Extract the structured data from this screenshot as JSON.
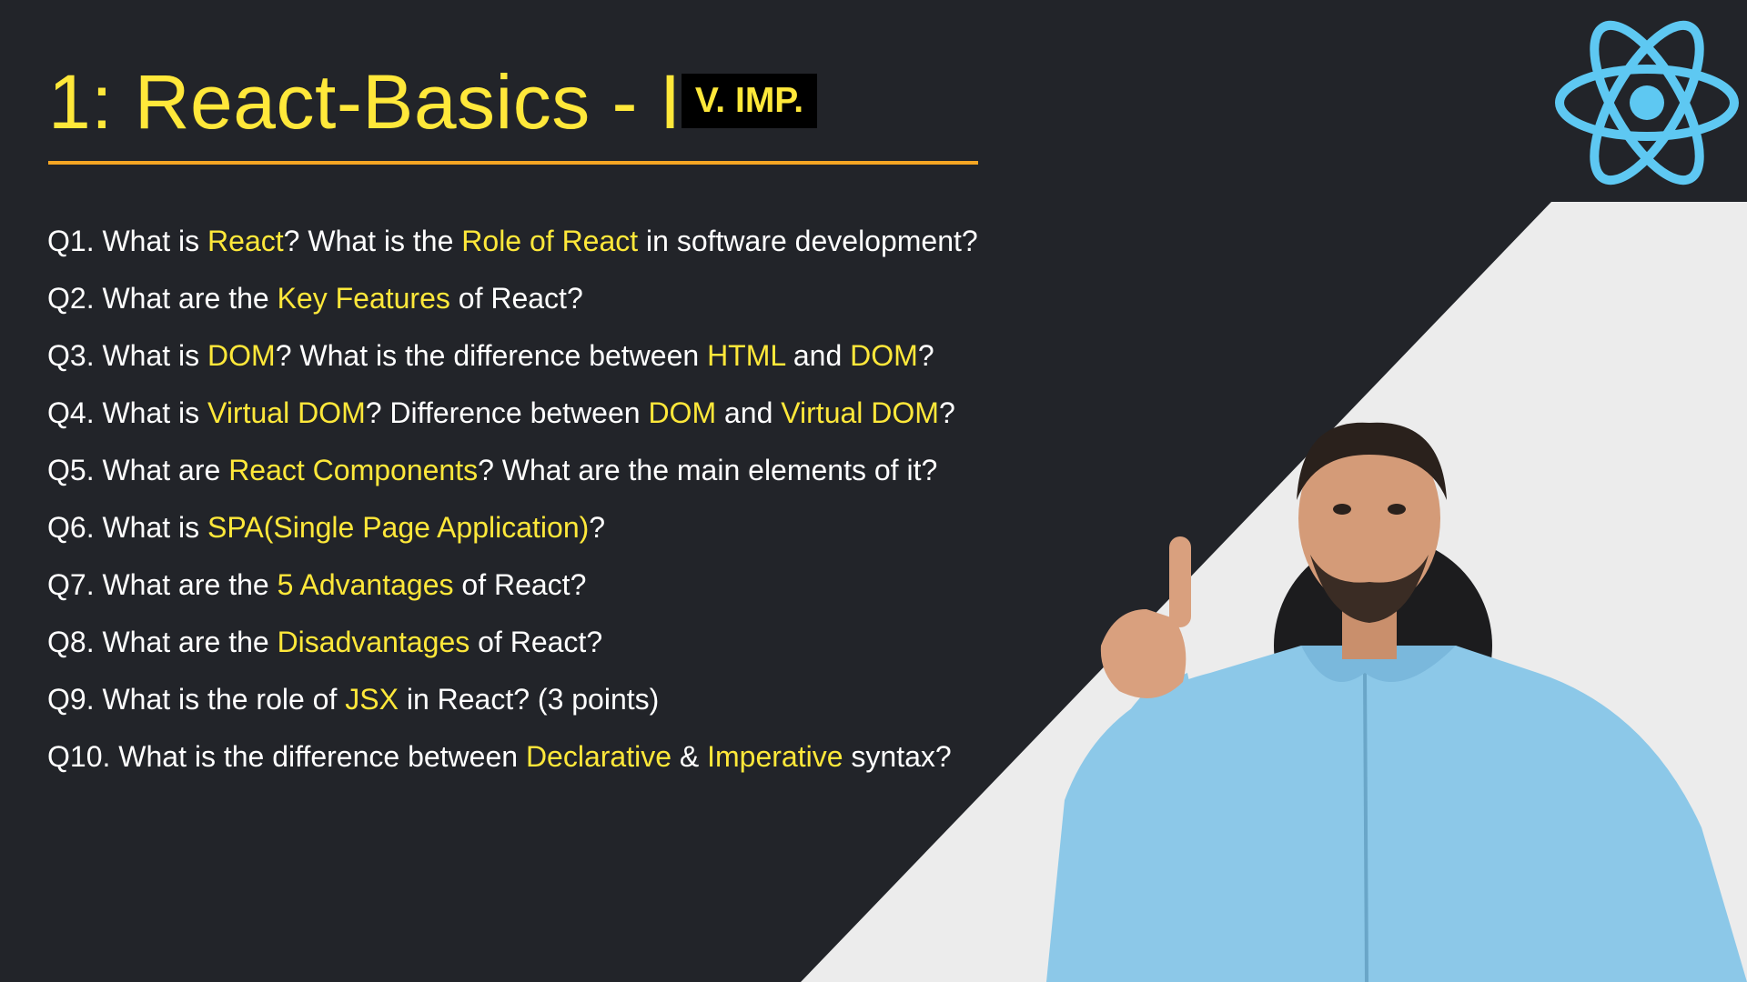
{
  "title": "1: React-Basics - I",
  "badge": "V. IMP.",
  "logo_icon": "react-atom-icon",
  "colors": {
    "background": "#222429",
    "highlight": "#ffe83a",
    "underline": "#f5a623",
    "react_logo": "#5ec8f2",
    "presenter_jacket": "#8cc8e8"
  },
  "questions": [
    {
      "parts": [
        {
          "text": "Q1. What is ",
          "hl": false
        },
        {
          "text": "React",
          "hl": true
        },
        {
          "text": "? What is the ",
          "hl": false
        },
        {
          "text": "Role of React",
          "hl": true
        },
        {
          "text": " in software development?",
          "hl": false
        }
      ]
    },
    {
      "parts": [
        {
          "text": "Q2. What are the ",
          "hl": false
        },
        {
          "text": "Key Features",
          "hl": true
        },
        {
          "text": " of React?",
          "hl": false
        }
      ]
    },
    {
      "parts": [
        {
          "text": "Q3. What is ",
          "hl": false
        },
        {
          "text": "DOM",
          "hl": true
        },
        {
          "text": "? What is the difference between ",
          "hl": false
        },
        {
          "text": "HTML",
          "hl": true
        },
        {
          "text": " and ",
          "hl": false
        },
        {
          "text": "DOM",
          "hl": true
        },
        {
          "text": "?",
          "hl": false
        }
      ]
    },
    {
      "parts": [
        {
          "text": "Q4. What is ",
          "hl": false
        },
        {
          "text": "Virtual DOM",
          "hl": true
        },
        {
          "text": "? Difference between ",
          "hl": false
        },
        {
          "text": "DOM",
          "hl": true
        },
        {
          "text": " and ",
          "hl": false
        },
        {
          "text": "Virtual DOM",
          "hl": true
        },
        {
          "text": "?",
          "hl": false
        }
      ]
    },
    {
      "parts": [
        {
          "text": "Q5. What are ",
          "hl": false
        },
        {
          "text": "React Components",
          "hl": true
        },
        {
          "text": "? What are the main elements of it?",
          "hl": false
        }
      ]
    },
    {
      "parts": [
        {
          "text": "Q6. What is ",
          "hl": false
        },
        {
          "text": "SPA(Single Page Application)",
          "hl": true
        },
        {
          "text": "?",
          "hl": false
        }
      ]
    },
    {
      "parts": [
        {
          "text": "Q7. What are the ",
          "hl": false
        },
        {
          "text": "5 Advantages",
          "hl": true
        },
        {
          "text": " of React?",
          "hl": false
        }
      ]
    },
    {
      "parts": [
        {
          "text": "Q8. What are the ",
          "hl": false
        },
        {
          "text": "Disadvantages",
          "hl": true
        },
        {
          "text": " of React?",
          "hl": false
        }
      ]
    },
    {
      "parts": [
        {
          "text": "Q9. What is the role of ",
          "hl": false
        },
        {
          "text": "JSX",
          "hl": true
        },
        {
          "text": " in React? (3 points)",
          "hl": false
        }
      ]
    },
    {
      "parts": [
        {
          "text": "Q10. What is the difference between ",
          "hl": false
        },
        {
          "text": "Declarative",
          "hl": true
        },
        {
          "text": " & ",
          "hl": false
        },
        {
          "text": "Imperative",
          "hl": true
        },
        {
          "text": " syntax?",
          "hl": false
        }
      ]
    }
  ]
}
